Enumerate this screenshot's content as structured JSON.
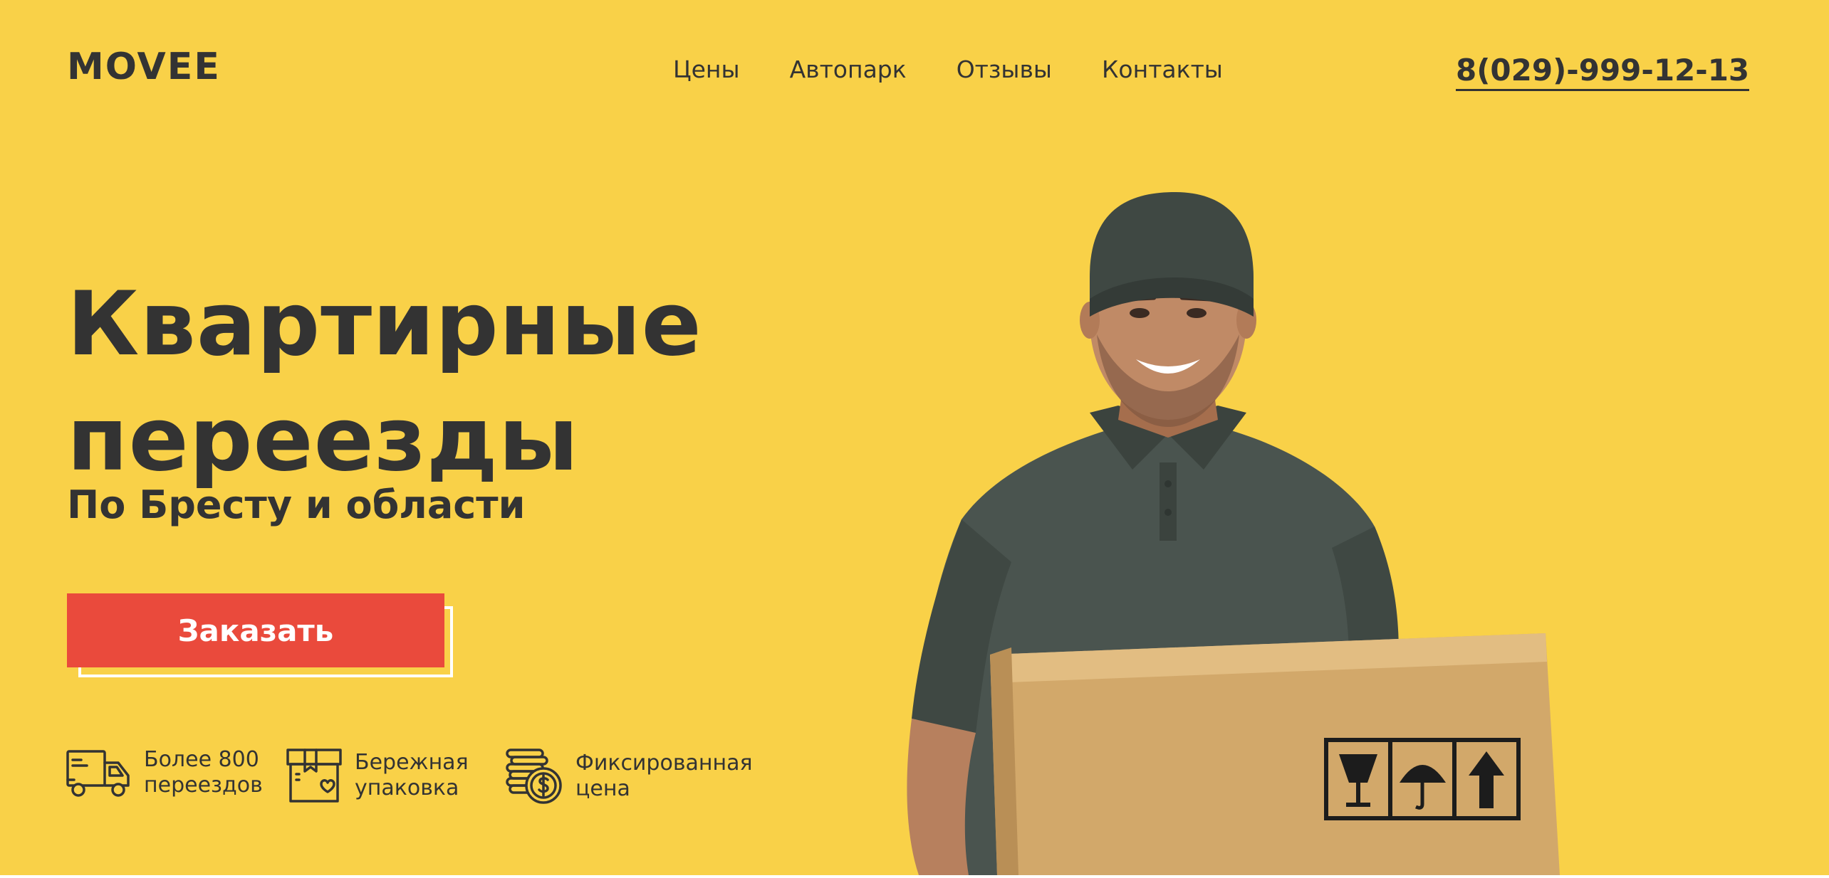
{
  "brand": {
    "logo": "MOVEE"
  },
  "nav": {
    "items": [
      "Цены",
      "Автопарк",
      "Отзывы",
      "Контакты"
    ]
  },
  "header": {
    "phone": "8(029)-999-12-13"
  },
  "hero": {
    "title_line1": "Квартирные",
    "title_line2": "переезды",
    "subtitle": "По Бресту и области",
    "cta": "Заказать"
  },
  "features": [
    {
      "icon": "truck-icon",
      "line1": "Более 800",
      "line2": "переездов"
    },
    {
      "icon": "box-heart-icon",
      "line1": "Бережная",
      "line2": "упаковка"
    },
    {
      "icon": "coins-icon",
      "line1": "Фиксированная",
      "line2": "цена"
    }
  ],
  "colors": {
    "background": "#f9d148",
    "text": "#333333",
    "accent_button": "#ea4a3c"
  }
}
